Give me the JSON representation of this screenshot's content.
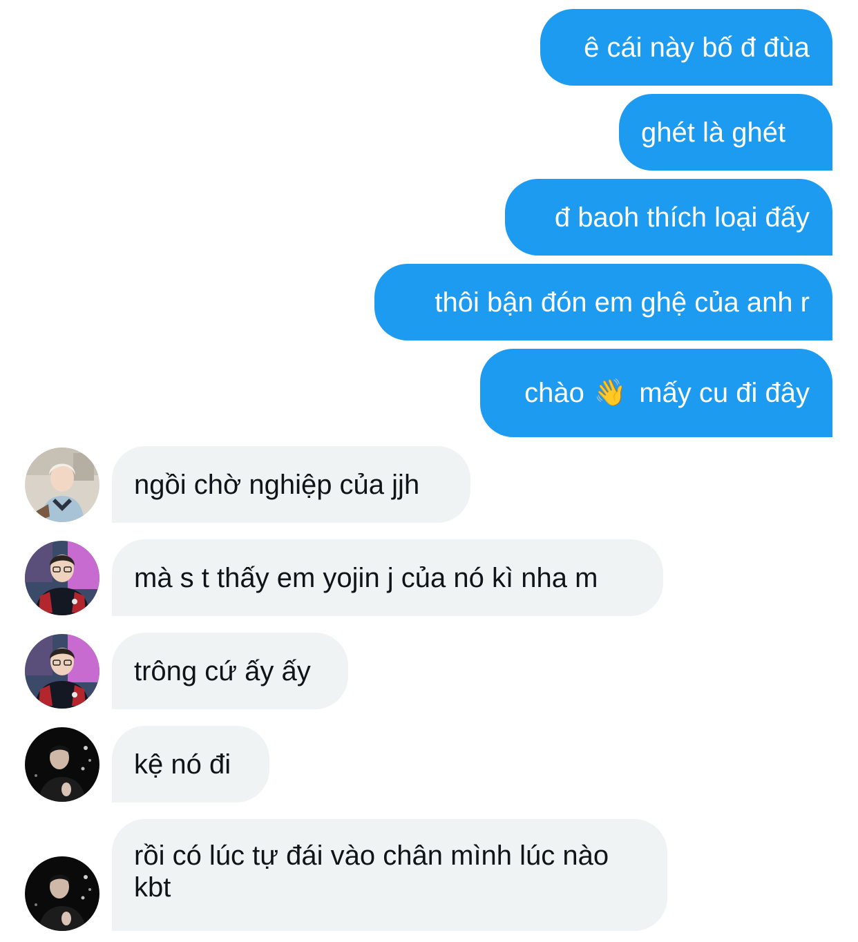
{
  "outgoing": [
    {
      "text": "ê cái này bố đ đùa"
    },
    {
      "text": "ghét là ghét"
    },
    {
      "text": "đ baoh thích loại đấy"
    },
    {
      "text": "thôi bận đón em ghệ của anh r"
    },
    {
      "text_before": "chào",
      "emoji": "👋",
      "text_after": "mấy cu đi đây"
    }
  ],
  "incoming": [
    {
      "text": "ngồi chờ nghiệp của jjh",
      "avatar": "avatar-light"
    },
    {
      "text": "mà s t thấy em yojin j của nó kì nha m",
      "avatar": "avatar-pink"
    },
    {
      "text": "trông cứ ấy ấy",
      "avatar": "avatar-pink"
    },
    {
      "text": "kệ nó đi",
      "avatar": "avatar-dark"
    },
    {
      "text": "rồi có lúc tự đái vào chân mình lúc nào kbt",
      "avatar": "avatar-dark"
    }
  ],
  "colors": {
    "outgoing_bubble": "#1d9bf0",
    "incoming_bubble": "#eff3f4",
    "incoming_text": "#0f1419"
  }
}
